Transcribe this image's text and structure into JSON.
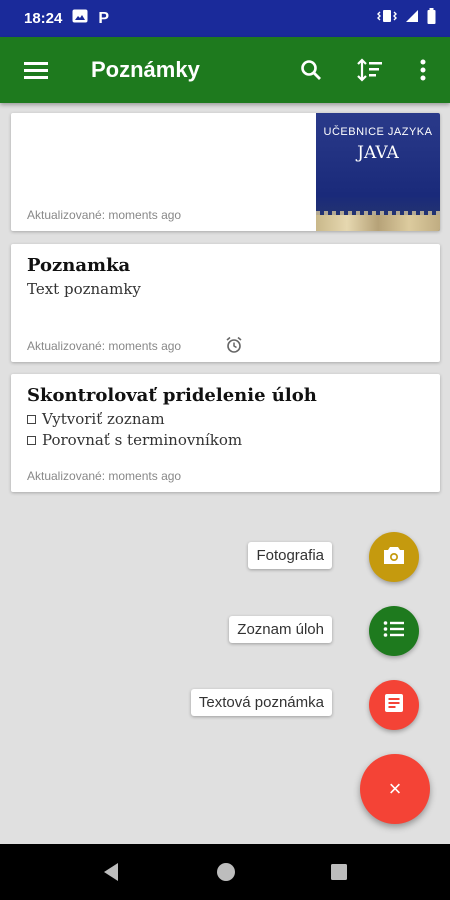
{
  "status_bar": {
    "time": "18:24",
    "icons": [
      "image-icon",
      "parking-icon",
      "vibrate-icon",
      "signal-icon",
      "battery-icon"
    ]
  },
  "app_bar": {
    "title": "Poznámky",
    "icons": [
      "menu-icon",
      "search-icon",
      "sort-icon",
      "more-vert-icon"
    ],
    "color": "#1e7a1e"
  },
  "notes": [
    {
      "type": "image",
      "meta": "Aktualizované: moments ago",
      "image": {
        "top_text": "UČEBNICE JAZYKA",
        "title": "JAVA"
      }
    },
    {
      "type": "text",
      "title": "Poznamka",
      "text": "Text poznamky",
      "meta": "Aktualizované: moments ago",
      "reminder_icon": "alarm-icon"
    },
    {
      "type": "checklist",
      "title": "Skontrolovať pridelenie úloh",
      "items": [
        "Vytvoriť zoznam",
        "Porovnať s terminovníkom"
      ],
      "meta": "Aktualizované: moments ago"
    }
  ],
  "fab_menu": {
    "actions": [
      {
        "label": "Fotografia",
        "icon": "camera-icon",
        "color": "#c59a0e"
      },
      {
        "label": "Zoznam úloh",
        "icon": "list-icon",
        "color": "#1e7a1e"
      },
      {
        "label": "Textová poznámka",
        "icon": "note-icon",
        "color": "#f44336"
      }
    ],
    "close_icon": "close-icon",
    "close_label": "×",
    "main_color": "#f44336"
  },
  "nav_bar": {
    "icons": [
      "back-icon",
      "home-icon",
      "recents-icon"
    ]
  }
}
